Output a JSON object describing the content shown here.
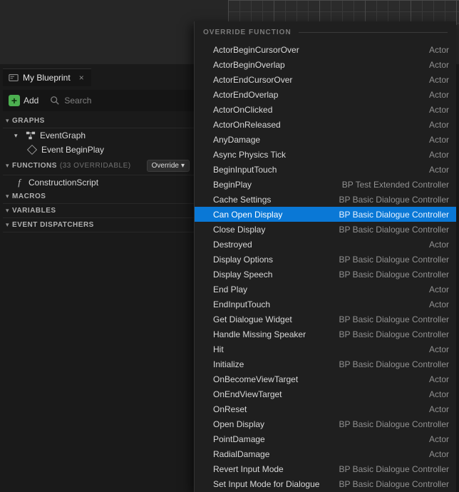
{
  "tab": {
    "title": "My Blueprint"
  },
  "toolbar": {
    "add_label": "Add",
    "search_placeholder": "Search"
  },
  "sections": {
    "graphs": {
      "title": "GRAPHS",
      "event_graph": "EventGraph",
      "begin_play_event": "Event BeginPlay"
    },
    "functions": {
      "title": "FUNCTIONS",
      "extra": "(33 OVERRIDABLE)",
      "override_btn": "Override",
      "construction_script": "ConstructionScript"
    },
    "macros": {
      "title": "MACROS"
    },
    "variables": {
      "title": "VARIABLES"
    },
    "event_dispatchers": {
      "title": "EVENT DISPATCHERS"
    }
  },
  "dropdown": {
    "header": "OVERRIDE FUNCTION",
    "selected_index": 11,
    "items": [
      {
        "label": "ActorBeginCursorOver",
        "src": "Actor"
      },
      {
        "label": "ActorBeginOverlap",
        "src": "Actor"
      },
      {
        "label": "ActorEndCursorOver",
        "src": "Actor"
      },
      {
        "label": "ActorEndOverlap",
        "src": "Actor"
      },
      {
        "label": "ActorOnClicked",
        "src": "Actor"
      },
      {
        "label": "ActorOnReleased",
        "src": "Actor"
      },
      {
        "label": "AnyDamage",
        "src": "Actor"
      },
      {
        "label": "Async Physics Tick",
        "src": "Actor"
      },
      {
        "label": "BeginInputTouch",
        "src": "Actor"
      },
      {
        "label": "BeginPlay",
        "src": "BP Test Extended Controller"
      },
      {
        "label": "Cache Settings",
        "src": "BP Basic Dialogue Controller"
      },
      {
        "label": "Can Open Display",
        "src": "BP Basic Dialogue Controller"
      },
      {
        "label": "Close Display",
        "src": "BP Basic Dialogue Controller"
      },
      {
        "label": "Destroyed",
        "src": "Actor"
      },
      {
        "label": "Display Options",
        "src": "BP Basic Dialogue Controller"
      },
      {
        "label": "Display Speech",
        "src": "BP Basic Dialogue Controller"
      },
      {
        "label": "End Play",
        "src": "Actor"
      },
      {
        "label": "EndInputTouch",
        "src": "Actor"
      },
      {
        "label": "Get Dialogue Widget",
        "src": "BP Basic Dialogue Controller"
      },
      {
        "label": "Handle Missing Speaker",
        "src": "BP Basic Dialogue Controller"
      },
      {
        "label": "Hit",
        "src": "Actor"
      },
      {
        "label": "Initialize",
        "src": "BP Basic Dialogue Controller"
      },
      {
        "label": "OnBecomeViewTarget",
        "src": "Actor"
      },
      {
        "label": "OnEndViewTarget",
        "src": "Actor"
      },
      {
        "label": "OnReset",
        "src": "Actor"
      },
      {
        "label": "Open Display",
        "src": "BP Basic Dialogue Controller"
      },
      {
        "label": "PointDamage",
        "src": "Actor"
      },
      {
        "label": "RadialDamage",
        "src": "Actor"
      },
      {
        "label": "Revert Input Mode",
        "src": "BP Basic Dialogue Controller"
      },
      {
        "label": "Set Input Mode for Dialogue",
        "src": "BP Basic Dialogue Controller"
      }
    ]
  }
}
